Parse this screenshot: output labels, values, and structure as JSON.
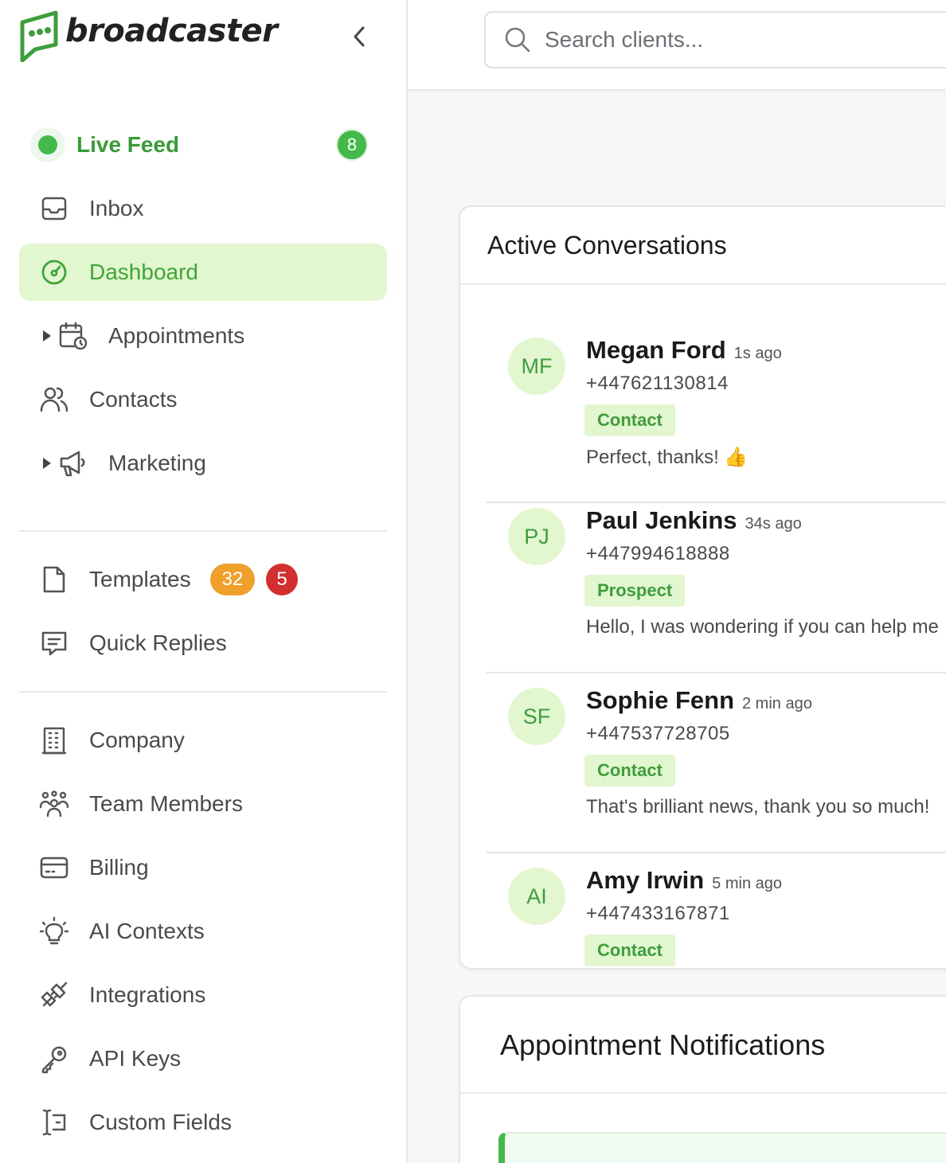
{
  "brand": {
    "name": "broadcaster"
  },
  "search": {
    "placeholder": "Search clients..."
  },
  "sidebar": {
    "live_feed": {
      "label": "Live Feed",
      "count": "8"
    },
    "items": [
      {
        "label": "Inbox",
        "icon": "inbox-icon"
      },
      {
        "label": "Dashboard",
        "icon": "gauge-icon",
        "active": true
      },
      {
        "label": "Appointments",
        "icon": "calendar-clock-icon",
        "expandable": true
      },
      {
        "label": "Contacts",
        "icon": "users-icon"
      },
      {
        "label": "Marketing",
        "icon": "megaphone-icon",
        "expandable": true
      }
    ],
    "templates": {
      "label": "Templates",
      "badge_primary": "32",
      "badge_secondary": "5"
    },
    "quick_replies": {
      "label": "Quick Replies"
    },
    "settings": [
      {
        "label": "Company",
        "icon": "building-icon"
      },
      {
        "label": "Team Members",
        "icon": "team-icon"
      },
      {
        "label": "Billing",
        "icon": "credit-card-icon"
      },
      {
        "label": "AI Contexts",
        "icon": "lightbulb-icon"
      },
      {
        "label": "Integrations",
        "icon": "plug-icon"
      },
      {
        "label": "API Keys",
        "icon": "key-icon"
      },
      {
        "label": "Custom Fields",
        "icon": "text-cursor-icon"
      }
    ]
  },
  "active_conversations": {
    "title": "Active Conversations",
    "items": [
      {
        "initials": "MF",
        "name": "Megan Ford",
        "time": "1s ago",
        "phone": "+447621130814",
        "tag": "Contact",
        "message": "Perfect, thanks! 👍"
      },
      {
        "initials": "PJ",
        "name": "Paul Jenkins",
        "time": "34s ago",
        "phone": "+447994618888",
        "tag": "Prospect",
        "message": "Hello, I was wondering if you can help me"
      },
      {
        "initials": "SF",
        "name": "Sophie Fenn",
        "time": "2 min ago",
        "phone": "+447537728705",
        "tag": "Contact",
        "message": "That's brilliant news, thank you so much!"
      },
      {
        "initials": "AI",
        "name": "Amy Irwin",
        "time": "5 min ago",
        "phone": "+447433167871",
        "tag": "Contact",
        "message": ""
      }
    ]
  },
  "appointment_notifications": {
    "title": "Appointment Notifications"
  },
  "colors": {
    "accent": "#43b949",
    "accent_light": "#e2f6d0",
    "accent_text": "#3f9d3c",
    "badge_orange": "#efa02b",
    "badge_red": "#d22f2f"
  }
}
